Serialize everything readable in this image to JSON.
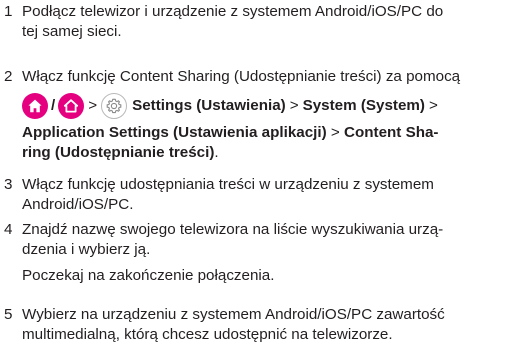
{
  "steps": [
    {
      "num": "1",
      "lines": [
        "Podłącz telewizor i urządzenie z systemem Android/iOS/PC do",
        "tej samej sieci."
      ]
    },
    {
      "num": "2",
      "line1": "Włącz funkcję Content Sharing (Udostępnianie treści) za pomocą",
      "slash": "/",
      "gt1": ">",
      "settings": "Settings (Ustawienia)",
      "gt2": ">",
      "system": "System (System)",
      "gt3": ">",
      "appsettings": "Application Settings (Ustawienia aplikacji)",
      "gt4": ">",
      "content1": "Content Sha-",
      "content2": "ring (Udostępnianie treści)",
      "end": "."
    },
    {
      "num": "3",
      "lines": [
        "Włącz funkcję udostępniania treści w urządzeniu z systemem",
        "Android/iOS/PC."
      ]
    },
    {
      "num": "4",
      "lines": [
        "Znajdź nazwę swojego telewizora na liście wyszukiwania urzą-",
        "dzenia i wybierz ją."
      ],
      "extra": "Poczekaj na zakończenie połączenia."
    },
    {
      "num": "5",
      "lines": [
        "Wybierz na urządzeniu z systemem Android/iOS/PC zawartość",
        "multimedialną, którą chcesz udostępnić na telewizorze."
      ]
    }
  ],
  "icons": [
    "home-icon",
    "home-icon",
    "gear-icon"
  ],
  "colors": {
    "text": "#231f20",
    "home_icon_bg": "#e4007f",
    "gear_icon_border": "#b9b9b9"
  }
}
